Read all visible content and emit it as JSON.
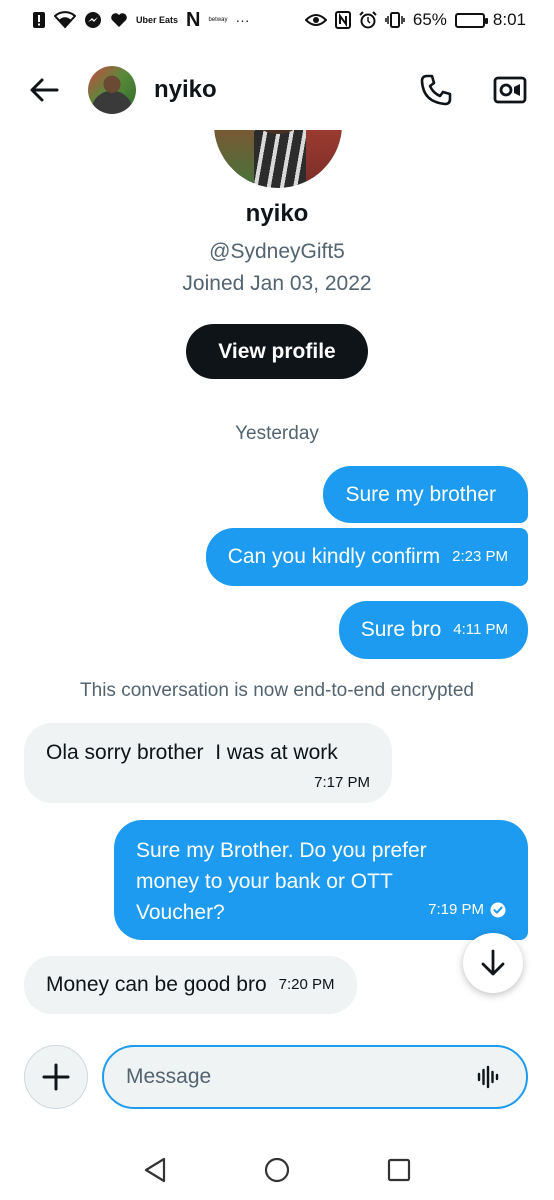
{
  "status_bar": {
    "uber_eats_label": "Uber Eats",
    "n_label": "N",
    "betway_label": "betway",
    "more_label": "···",
    "battery_percent": "65%",
    "battery_level": 0.65,
    "time": "8:01"
  },
  "header": {
    "name": "nyiko"
  },
  "profile": {
    "name": "nyiko",
    "handle": "@SydneyGift5",
    "joined": "Joined Jan 03, 2022",
    "view_profile_label": "View profile"
  },
  "conversation": {
    "day_separator": "Yesterday",
    "encryption_note": "This conversation is now end-to-end encrypted",
    "messages": [
      {
        "direction": "sent",
        "text": "Sure my brother",
        "time": ""
      },
      {
        "direction": "sent",
        "text": "Can you kindly confirm",
        "time": "2:23 PM"
      },
      {
        "direction": "sent",
        "text": "Sure bro",
        "time": "4:11 PM"
      },
      {
        "direction": "received",
        "text": "Ola sorry brother  I was at work",
        "time": "7:17 PM"
      },
      {
        "direction": "sent",
        "text": "Sure my Brother. Do you prefer money to your bank or OTT Voucher?",
        "time": "7:19 PM",
        "read": true
      },
      {
        "direction": "received",
        "text": "Money can be good bro",
        "time": "7:20 PM"
      }
    ]
  },
  "composer": {
    "placeholder": "Message",
    "value": ""
  },
  "colors": {
    "accent": "#1d9bf0",
    "received_bubble": "#eff3f4",
    "text_primary": "#0f1419",
    "text_secondary": "#536471"
  },
  "icons": {
    "back": "back-arrow-icon",
    "call": "phone-icon",
    "video": "video-camera-icon",
    "scroll_down": "arrow-down-icon",
    "add": "plus-icon",
    "voice": "voice-waveform-icon",
    "read_receipt": "check-circle-icon"
  }
}
